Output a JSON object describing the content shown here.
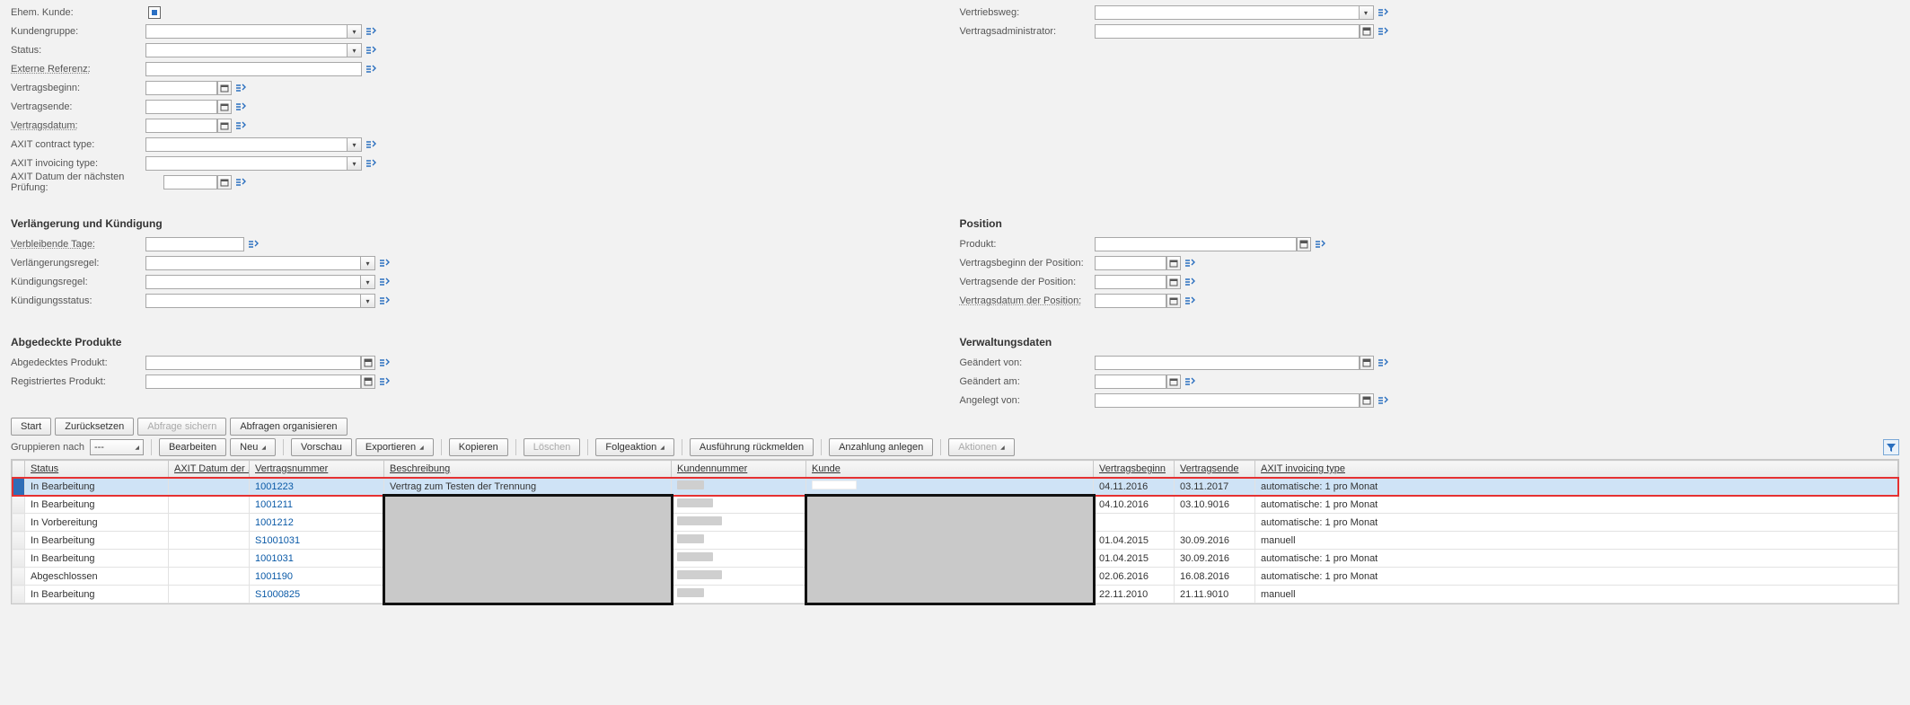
{
  "form_left": {
    "ehem_kunde": "Ehem. Kunde:",
    "kundengruppe": "Kundengruppe:",
    "status": "Status:",
    "externe_referenz": "Externe Referenz:",
    "vertragsbeginn": "Vertragsbeginn:",
    "vertragsende": "Vertragsende:",
    "vertragsdatum": "Vertragsdatum:",
    "axit_ctype": "AXIT contract type:",
    "axit_itype": "AXIT invoicing type:",
    "axit_next_check": "AXIT Datum der nächsten Prüfung:"
  },
  "form_right": {
    "vertriebsweg": "Vertriebsweg:",
    "vertragsadmin": "Vertragsadministrator:"
  },
  "sec_vk": {
    "title": "Verlängerung und Kündigung",
    "verbl_tage": "Verbleibende Tage:",
    "verl_regel": "Verlängerungsregel:",
    "kuend_regel": "Kündigungsregel:",
    "kuend_status": "Kündigungsstatus:"
  },
  "sec_pos": {
    "title": "Position",
    "produkt": "Produkt:",
    "vbeg_pos": "Vertragsbeginn der Position:",
    "vend_pos": "Vertragsende der Position:",
    "vdat_pos": "Vertragsdatum der Position:"
  },
  "sec_ap": {
    "title": "Abgedeckte Produkte",
    "abg_prod": "Abgedecktes Produkt:",
    "reg_prod": "Registriertes Produkt:"
  },
  "sec_vd": {
    "title": "Verwaltungsdaten",
    "geaendert_von": "Geändert von:",
    "geaendert_am": "Geändert am:",
    "angelegt_von": "Angelegt von:"
  },
  "toolbar1": {
    "start": "Start",
    "zurueck": "Zurücksetzen",
    "abfrage_sichern": "Abfrage sichern",
    "abfragen_org": "Abfragen organisieren"
  },
  "toolbar2": {
    "gruppieren": "Gruppieren nach",
    "gruppieren_val": "---",
    "bearbeiten": "Bearbeiten",
    "neu": "Neu",
    "vorschau": "Vorschau",
    "exportieren": "Exportieren",
    "kopieren": "Kopieren",
    "loeschen": "Löschen",
    "folgeaktion": "Folgeaktion",
    "ausfuehrung": "Ausführung rückmelden",
    "anzahlung": "Anzahlung anlegen",
    "aktionen": "Aktionen"
  },
  "columns": {
    "status": "Status",
    "axit_date": "AXIT Datum der ...",
    "vnr": "Vertragsnummer",
    "beschr": "Beschreibung",
    "knr": "Kundennummer",
    "kunde": "Kunde",
    "vbeg": "Vertragsbeginn",
    "vend": "Vertragsende",
    "ainv": "AXIT invoicing type"
  },
  "rows": [
    {
      "status": "In Bearbeitung",
      "vnr": "1001223",
      "beschr": "Vertrag zum Testen der Trennung",
      "vbeg": "04.11.2016",
      "vend": "03.11.2017",
      "ainv": "automatische: 1 pro Monat",
      "selected": true
    },
    {
      "status": "In Bearbeitung",
      "vnr": "1001211",
      "beschr": "",
      "vbeg": "04.10.2016",
      "vend": "03.10.9016",
      "ainv": "automatische: 1 pro Monat"
    },
    {
      "status": "In Vorbereitung",
      "vnr": "1001212",
      "beschr": "",
      "vbeg": "",
      "vend": "",
      "ainv": "automatische: 1 pro Monat"
    },
    {
      "status": "In Bearbeitung",
      "vnr": "S1001031",
      "beschr": "",
      "vbeg": "01.04.2015",
      "vend": "30.09.2016",
      "ainv": "manuell"
    },
    {
      "status": "In Bearbeitung",
      "vnr": "1001031",
      "beschr": "",
      "vbeg": "01.04.2015",
      "vend": "30.09.2016",
      "ainv": "automatische: 1 pro Monat"
    },
    {
      "status": "Abgeschlossen",
      "vnr": "1001190",
      "beschr": "",
      "vbeg": "02.06.2016",
      "vend": "16.08.2016",
      "ainv": "automatische: 1 pro Monat"
    },
    {
      "status": "In Bearbeitung",
      "vnr": "S1000825",
      "beschr": "",
      "vbeg": "22.11.2010",
      "vend": "21.11.9010",
      "ainv": "manuell"
    }
  ]
}
